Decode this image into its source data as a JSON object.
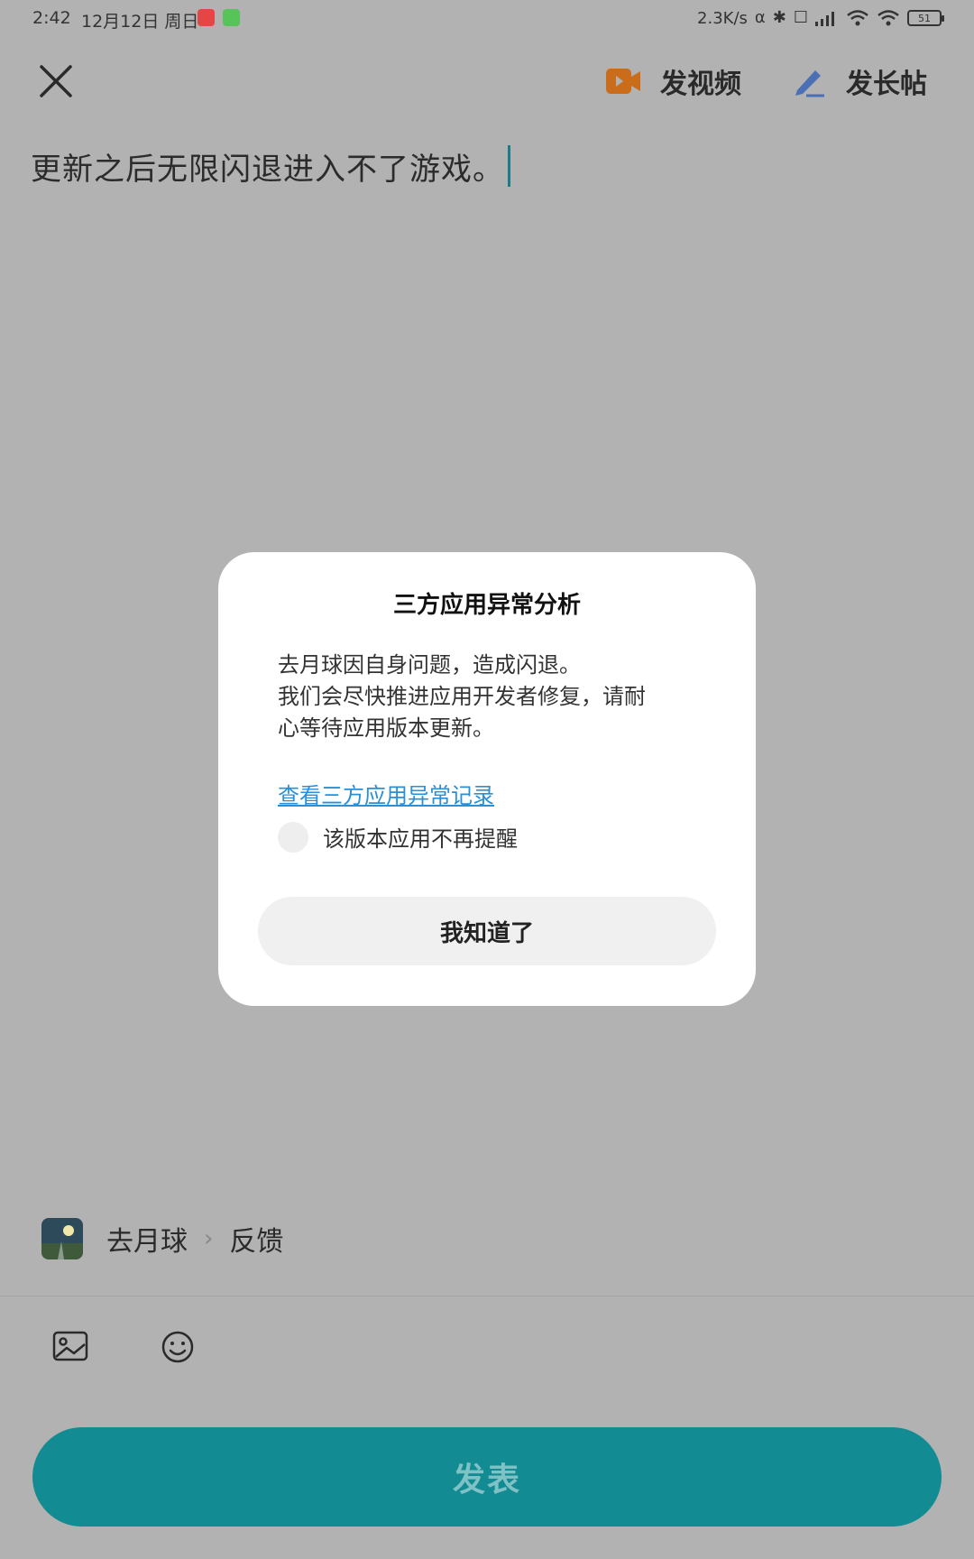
{
  "status_bar": {
    "time": "2:42",
    "date": "12月12日 周日",
    "net_speed": "2.3K/s",
    "battery": "51",
    "icons": [
      "app-icon-red",
      "app-icon-green",
      "headphones-icon",
      "bluetooth-icon",
      "mute-icon",
      "signal-icon",
      "wifi-icon",
      "wifi-icon-2",
      "battery-icon"
    ]
  },
  "toolbar": {
    "video_label": "发视频",
    "long_post_label": "发长帖"
  },
  "editor": {
    "text": "更新之后无限闪退进入不了游戏。"
  },
  "dialog": {
    "title": "三方应用异常分析",
    "body_lines": [
      "去月球因自身问题，造成闪退。",
      "我们会尽快推进应用开发者修复，请耐",
      "心等待应用版本更新。"
    ],
    "link": "查看三方应用异常记录",
    "checkbox_label": "该版本应用不再提醒",
    "checkbox_checked": false,
    "confirm_button": "我知道了"
  },
  "forum": {
    "name": "去月球",
    "separator": "›",
    "board": "反馈"
  },
  "publish_button": "发表",
  "colors": {
    "overlay_bg": "#b2b2b2",
    "accent": "#138b92",
    "link": "#2a8fd6",
    "video_icon": "#c96d1b",
    "pen_icon": "#4a6fb5"
  }
}
